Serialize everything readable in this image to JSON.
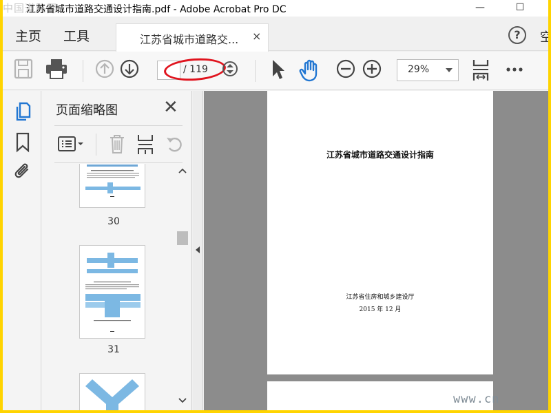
{
  "window": {
    "title": "江苏省城市道路交通设计指南.pdf - Adobe Acrobat Pro DC",
    "watermark": "中国道路网",
    "minimize": "—",
    "maximize": "☐"
  },
  "tabbar": {
    "home": "主页",
    "tools": "工具",
    "doc_tab_label": "江苏省城市道路交...",
    "doc_tab_close": "×",
    "help": "?",
    "more": "空"
  },
  "toolbar": {
    "page_input_value": "",
    "page_total": "/ 119",
    "zoom_value": "29%"
  },
  "thumbnail_panel": {
    "title": "页面缩略图",
    "close": "✕",
    "pages": [
      {
        "number": "30"
      },
      {
        "number": "31"
      }
    ]
  },
  "document": {
    "heading": "江苏省城市道路交通设计指南",
    "organization": "江苏省住房和城乡建设厅",
    "date": "2015 年 12 月"
  },
  "overlay": {
    "watermark_url": "www.cn"
  },
  "colors": {
    "highlight_ellipse": "#e0141e",
    "accent_blue": "#2277d2",
    "border_frame": "#ffd400"
  }
}
